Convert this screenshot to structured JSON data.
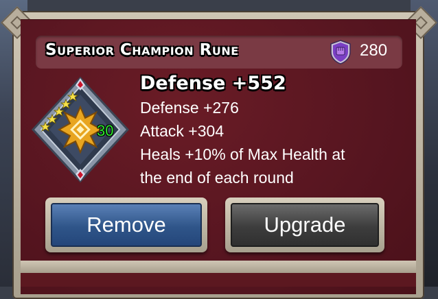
{
  "header": {
    "rune_title": "Superior Champion Rune",
    "cost": "280",
    "cost_icon": "purple-fist-shield-icon"
  },
  "rune": {
    "level": "30",
    "stars": 5,
    "headline": "Defense +552",
    "stats": [
      "Defense +276",
      "Attack +304",
      "Heals +10% of Max Health at",
      "the end of each round"
    ]
  },
  "buttons": {
    "remove": "Remove",
    "upgrade": "Upgrade"
  },
  "colors": {
    "panel": "#5c1820",
    "title_bar": "#7a3a44",
    "remove_button": "#2f5589",
    "upgrade_button": "#3d3d3d",
    "level_text": "#2ee82e"
  }
}
